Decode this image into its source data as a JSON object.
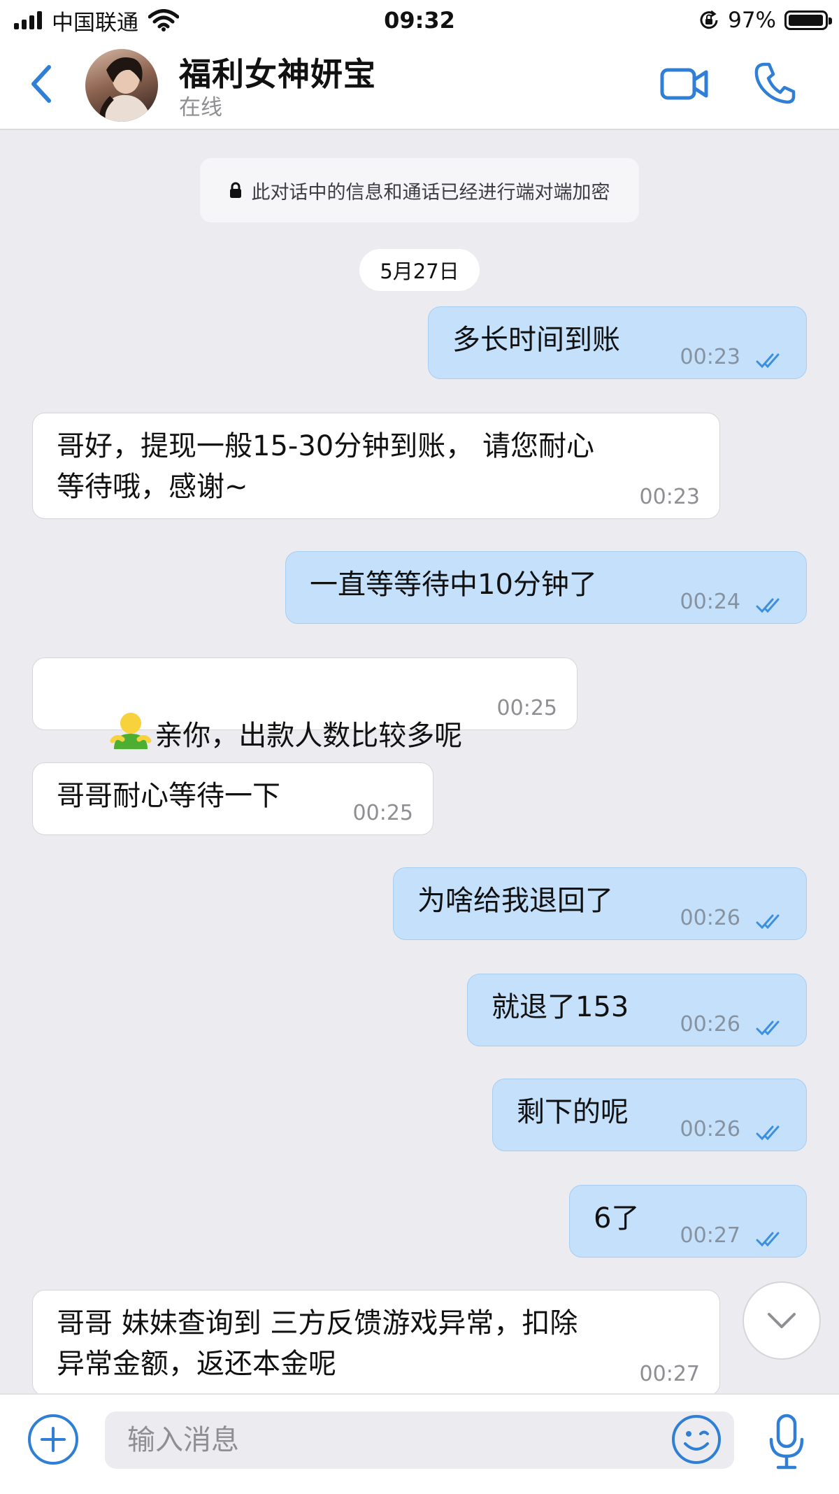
{
  "status_bar": {
    "carrier": "中国联通",
    "time": "09:32",
    "battery_percent": "97%",
    "battery_level": 0.97
  },
  "header": {
    "contact_name": "福利女神妍宝",
    "contact_status": "在线",
    "icons": [
      "back-icon",
      "video-call-icon",
      "phone-icon"
    ]
  },
  "chat": {
    "encryption_notice": "此对话中的信息和通话已经进行端对端加密",
    "date_label": "5月27日",
    "messages": [
      {
        "direction": "out",
        "text": "多长时间到账",
        "time": "00:23",
        "status": "read"
      },
      {
        "direction": "in",
        "text": "哥好，提现一般15-30分钟到账， 请您耐心\n等待哦，感谢~",
        "time": "00:23"
      },
      {
        "direction": "out",
        "text": "一直等等待中10分钟了",
        "time": "00:24",
        "status": "read"
      },
      {
        "direction": "in",
        "text": "亲你，出款人数比较多呢",
        "time": "00:25",
        "emoji": "person-emoji"
      },
      {
        "direction": "in",
        "text": "哥哥耐心等待一下",
        "time": "00:25"
      },
      {
        "direction": "out",
        "text": "为啥给我退回了",
        "time": "00:26",
        "status": "read"
      },
      {
        "direction": "out",
        "text": "就退了153",
        "time": "00:26",
        "status": "read"
      },
      {
        "direction": "out",
        "text": "剩下的呢",
        "time": "00:26",
        "status": "read"
      },
      {
        "direction": "out",
        "text": "6了",
        "time": "00:27",
        "status": "read"
      },
      {
        "direction": "in",
        "text": "哥哥 妹妹查询到 三方反馈游戏异常，扣除\n异常金额，返还本金呢",
        "time": "00:27"
      }
    ]
  },
  "input_bar": {
    "placeholder": "输入消息",
    "value": ""
  },
  "colors": {
    "accent": "#2f7fd6",
    "outgoing_bubble": "#c4e0fb",
    "incoming_bubble": "#ffffff",
    "chat_background": "#ececf0"
  }
}
